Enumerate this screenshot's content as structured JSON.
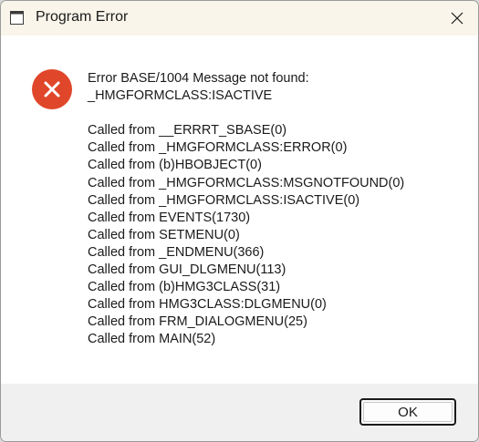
{
  "window": {
    "title": "Program Error",
    "close_icon": "close-icon"
  },
  "dialog": {
    "icon": "error-icon",
    "error_lines": [
      "Error BASE/1004  Message not found:",
      "_HMGFORMCLASS:ISACTIVE"
    ],
    "call_stack": [
      "Called from __ERRRT_SBASE(0)",
      "Called from _HMGFORMCLASS:ERROR(0)",
      "Called from (b)HBOBJECT(0)",
      "Called from _HMGFORMCLASS:MSGNOTFOUND(0)",
      "Called from _HMGFORMCLASS:ISACTIVE(0)",
      "Called from EVENTS(1730)",
      "Called from SETMENU(0)",
      "Called from _ENDMENU(366)",
      "Called from GUI_DLGMENU(113)",
      "Called from (b)HMG3CLASS(31)",
      "Called from HMG3CLASS:DLGMENU(0)",
      "Called from FRM_DIALOGMENU(25)",
      "Called from MAIN(52)"
    ]
  },
  "buttons": {
    "ok_label": "OK"
  },
  "colors": {
    "titlebar_bg": "#f9f5ea",
    "error_red": "#e0472a",
    "footer_bg": "#f0f0f0"
  }
}
